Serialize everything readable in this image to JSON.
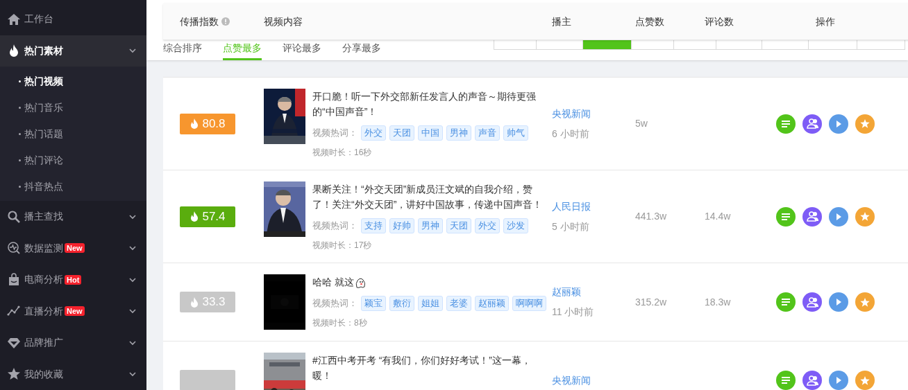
{
  "sidebar": {
    "items": [
      {
        "label": "工作台",
        "expanded": false
      },
      {
        "label": "热门素材",
        "expanded": true,
        "children": [
          {
            "label": "热门视频",
            "selected": true
          },
          {
            "label": "热门音乐",
            "selected": false
          },
          {
            "label": "热门话题",
            "selected": false
          },
          {
            "label": "热门评论",
            "selected": false
          },
          {
            "label": "抖音热点",
            "selected": false
          }
        ]
      },
      {
        "label": "播主查找",
        "expanded": false
      },
      {
        "label": "数据监测",
        "expanded": false,
        "badge": "New"
      },
      {
        "label": "电商分析",
        "expanded": false,
        "badge": "Hot"
      },
      {
        "label": "直播分析",
        "expanded": false,
        "badge": "New"
      },
      {
        "label": "品牌推广",
        "expanded": false
      },
      {
        "label": "我的收藏",
        "expanded": false
      }
    ]
  },
  "sort_tabs": [
    {
      "label": "综合排序",
      "selected": false
    },
    {
      "label": "点赞最多",
      "selected": true
    },
    {
      "label": "评论最多",
      "selected": false
    },
    {
      "label": "分享最多",
      "selected": false
    }
  ],
  "time_filters": [
    {
      "selected": false
    },
    {
      "selected": false
    },
    {
      "selected": true
    },
    {
      "selected": false
    },
    {
      "selected": false
    },
    {
      "selected": false
    },
    {
      "selected": false
    },
    {
      "selected": false
    },
    {
      "selected": false
    }
  ],
  "table": {
    "columns": [
      "传播指数",
      "视频内容",
      "播主",
      "点赞数",
      "评论数",
      "操作"
    ],
    "rows": [
      {
        "score": "80.8",
        "color": "#f7962e",
        "title": "开口脆！听一下外交部新任发言人的声音～期待更强的“中国声音”！",
        "tags_label": "视频热词：",
        "tags": [
          "外交",
          "天团",
          "中国",
          "男神",
          "声音",
          "帅气"
        ],
        "duration": "视频时长：16秒",
        "host": "央视新闻",
        "time": "6 小时前",
        "likes": "5w"
      },
      {
        "score": "57.4",
        "color": "#5aad0e",
        "title": "果断关注！“外交天团”新成员汪文斌的自我介绍，赞了！关注“外交天团”，讲好中国故事，传递中国声音！",
        "tags_label": "视频热词：",
        "tags": [
          "支持",
          "好帅",
          "男神",
          "天团",
          "外交",
          "沙发"
        ],
        "duration": "视频时长：17秒",
        "host": "人民日报",
        "time": "5 小时前",
        "likes": "441.3w",
        "comments": "14.4w"
      },
      {
        "score": "33.3",
        "color": "#c8c8c8",
        "title": "哈哈 就这",
        "emoji": true,
        "tags_label": "视频热词：",
        "tags": [
          "颖宝",
          "敷衍",
          "姐姐",
          "老婆",
          "赵丽颖",
          "啊啊啊"
        ],
        "duration": "视频时长：8秒",
        "host": "赵丽颖",
        "time": "11 小时前",
        "likes": "315.2w",
        "comments": "18.3w"
      },
      {
        "color": "#c8c8c8",
        "title": "#江西中考开考 “有我们，你们好好考试！”这一幕，暖！",
        "host": "央视新闻"
      }
    ]
  }
}
